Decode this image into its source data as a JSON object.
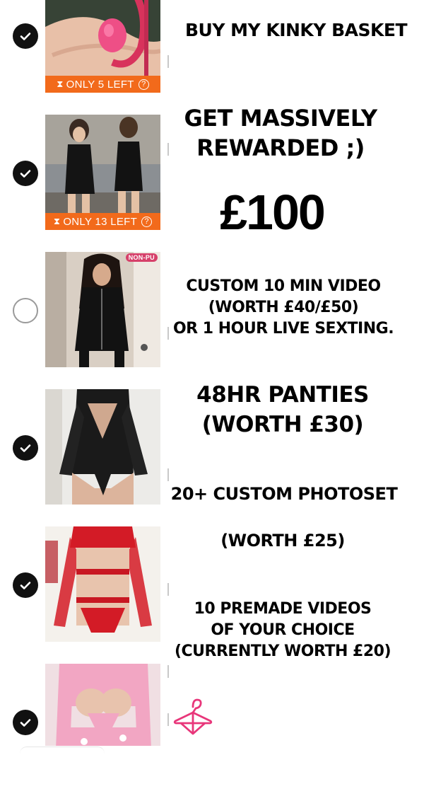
{
  "colors": {
    "check_dark": "#111111",
    "stock_badge": "#f26a1b",
    "hanger": "#e8367a"
  },
  "items": [
    {
      "checked": true,
      "image_icon": "red-leather-collar-photo",
      "stock_label": "ONLY 5 LEFT"
    },
    {
      "checked": true,
      "image_icon": "black-leather-playsuit-photo",
      "stock_label": "ONLY 13 LEFT"
    },
    {
      "checked": false,
      "image_icon": "black-zip-bodysuit-photo",
      "badge": "NON-PU"
    },
    {
      "checked": true,
      "image_icon": "black-lace-bodysuit-photo"
    },
    {
      "checked": true,
      "image_icon": "red-mesh-lingerie-photo"
    },
    {
      "checked": true,
      "image_icon": "pink-print-lingerie-photo"
    }
  ],
  "overlay": {
    "title": "BUY MY KINKY BASKET",
    "reward_line1": "GET MASSIVELY",
    "reward_line2": "REWARDED ;)",
    "price": "£100",
    "custom_line1": "CUSTOM 10 MIN VIDEO",
    "custom_line2": "(WORTH £40/£50)",
    "custom_line3": "OR 1 HOUR LIVE SEXTING.",
    "panties_line1": "48HR PANTIES",
    "panties_line2": "(WORTH £30)",
    "photoset_line": "20+ CUSTOM PHOTOSET",
    "photoset_worth": "(WORTH £25)",
    "premade_line1": "10 PREMADE VIDEOS",
    "premade_line2": "OF YOUR CHOICE",
    "premade_line3": "(CURRENTLY WORTH £20)",
    "hanger_icon": "hanger-icon"
  }
}
